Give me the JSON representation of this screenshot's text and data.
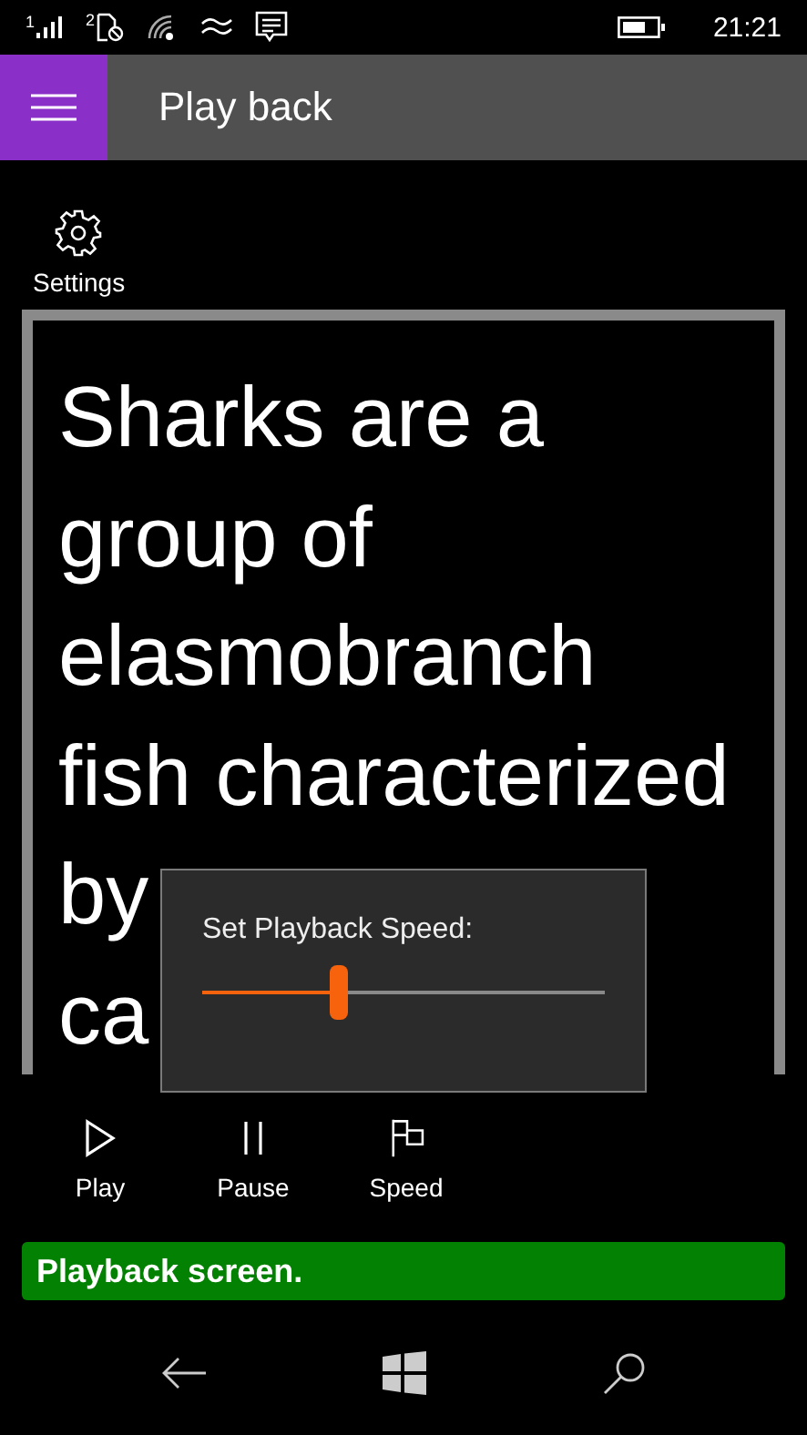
{
  "status_bar": {
    "sim_1": "1",
    "sim_2": "2",
    "time": "21:21"
  },
  "header": {
    "title": "Play back"
  },
  "settings": {
    "label": "Settings"
  },
  "content": {
    "lines": [
      "Sharks are a",
      "group of",
      "elasmobranch",
      "fish characterized",
      "by",
      "ca"
    ]
  },
  "popup": {
    "title": "Set Playback Speed:",
    "slider": {
      "level": 0.34
    }
  },
  "app_bar": [
    {
      "kind": "play",
      "label": "Play"
    },
    {
      "kind": "pause",
      "label": "Pause"
    },
    {
      "kind": "speed",
      "label": "Speed"
    }
  ],
  "status_message": "Playback screen."
}
